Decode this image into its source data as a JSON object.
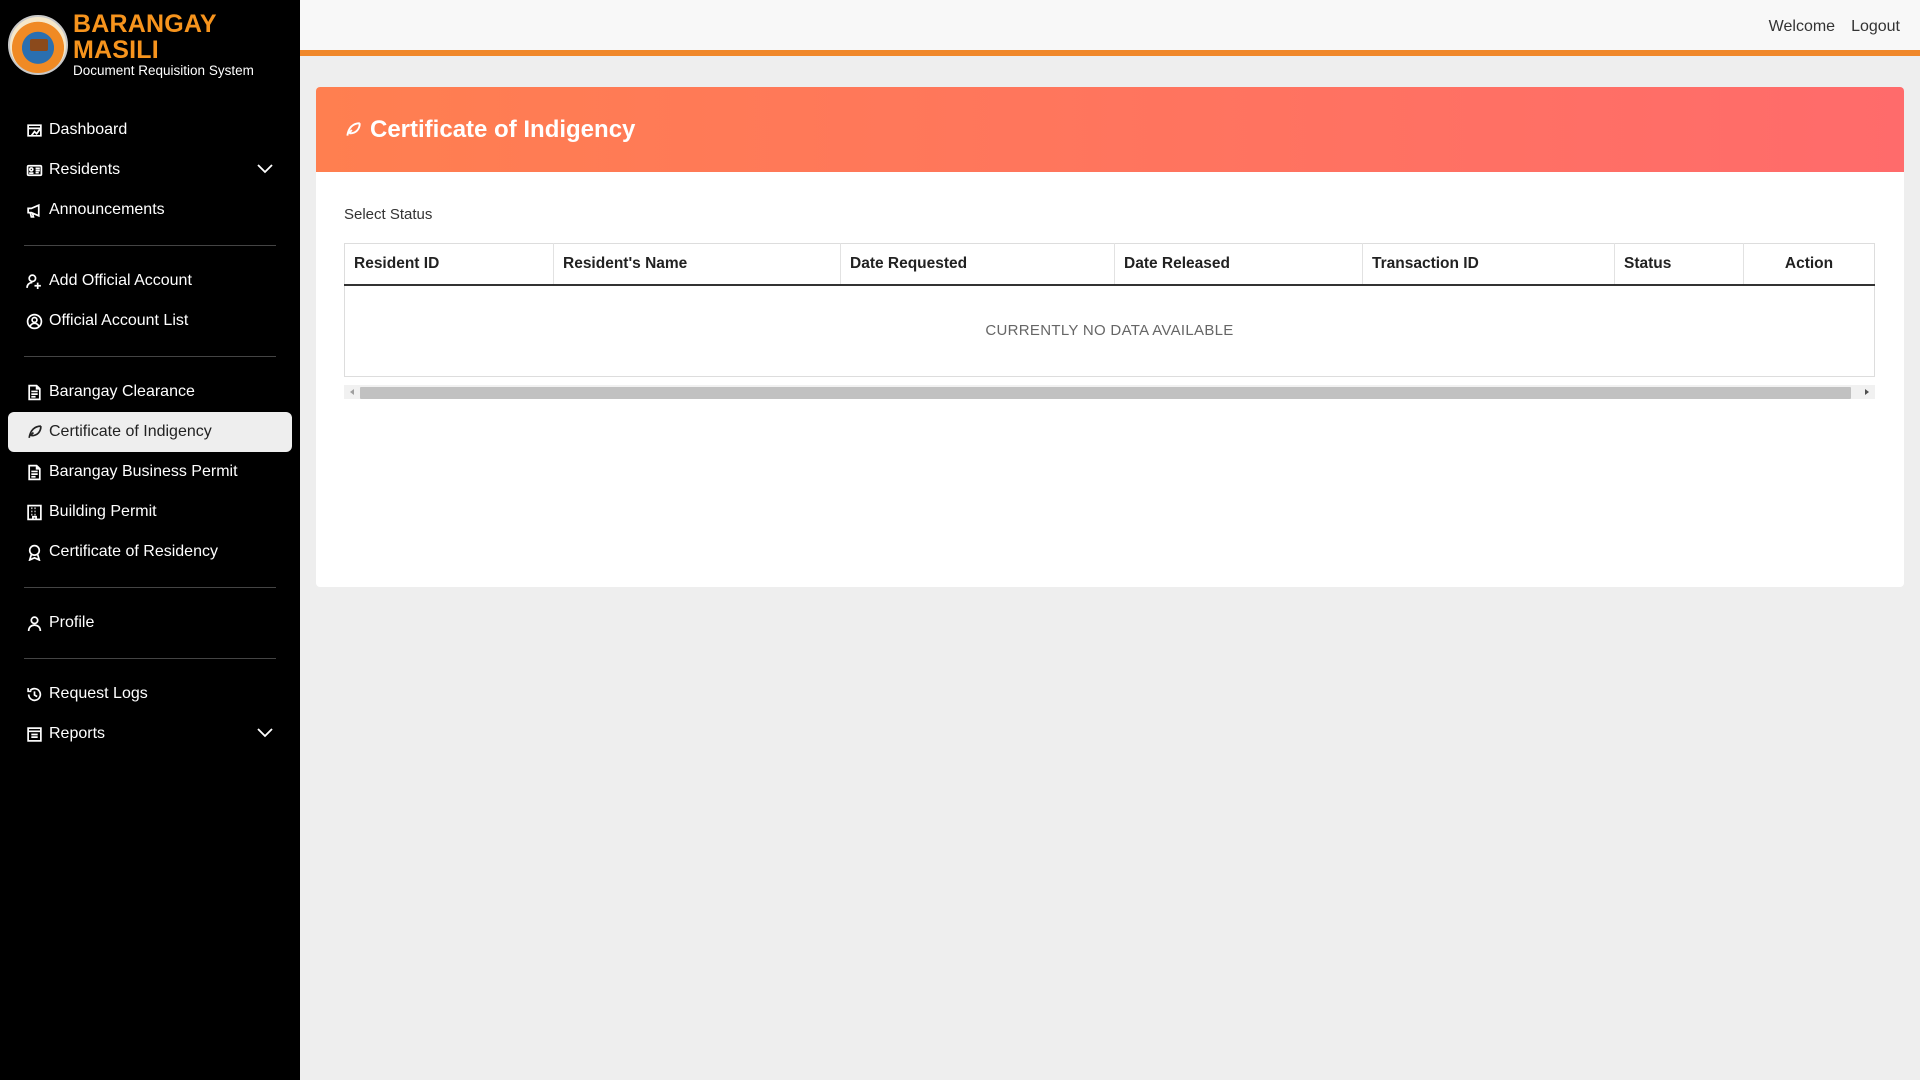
{
  "brand": {
    "title": "BARANGAY MASILI",
    "subtitle": "Document Requisition System"
  },
  "sidebar": {
    "items": [
      {
        "label": "Dashboard",
        "icon": "dashboard-icon"
      },
      {
        "label": "Residents",
        "icon": "id-card-icon"
      },
      {
        "label": "Announcements",
        "icon": "megaphone-icon"
      },
      {
        "label": "Add Official Account",
        "icon": "user-plus-icon"
      },
      {
        "label": "Official Account List",
        "icon": "user-circle-icon"
      },
      {
        "label": "Barangay Clearance",
        "icon": "document-icon"
      },
      {
        "label": "Certificate of Indigency",
        "icon": "feather-icon"
      },
      {
        "label": "Barangay Business Permit",
        "icon": "document-icon"
      },
      {
        "label": "Building Permit",
        "icon": "building-icon"
      },
      {
        "label": "Certificate of Residency",
        "icon": "award-icon"
      },
      {
        "label": "Profile",
        "icon": "person-icon"
      },
      {
        "label": "Request Logs",
        "icon": "history-icon"
      },
      {
        "label": "Reports",
        "icon": "report-icon"
      }
    ],
    "active": "Certificate of Indigency"
  },
  "topbar": {
    "welcome": "Welcome",
    "logout": "Logout"
  },
  "page": {
    "title": "Certificate of Indigency",
    "select_status": "Select Status",
    "table": {
      "columns": [
        "Resident ID",
        "Resident's Name",
        "Date Requested",
        "Date Released",
        "Transaction ID",
        "Status",
        "Action"
      ],
      "empty_message": "CURRENTLY NO DATA AVAILABLE"
    }
  },
  "colors": {
    "accent": "#f7941d",
    "header_gradient_start": "#ff7f50",
    "header_gradient_end": "#ff6b6b",
    "sidebar_bg": "#000000"
  }
}
